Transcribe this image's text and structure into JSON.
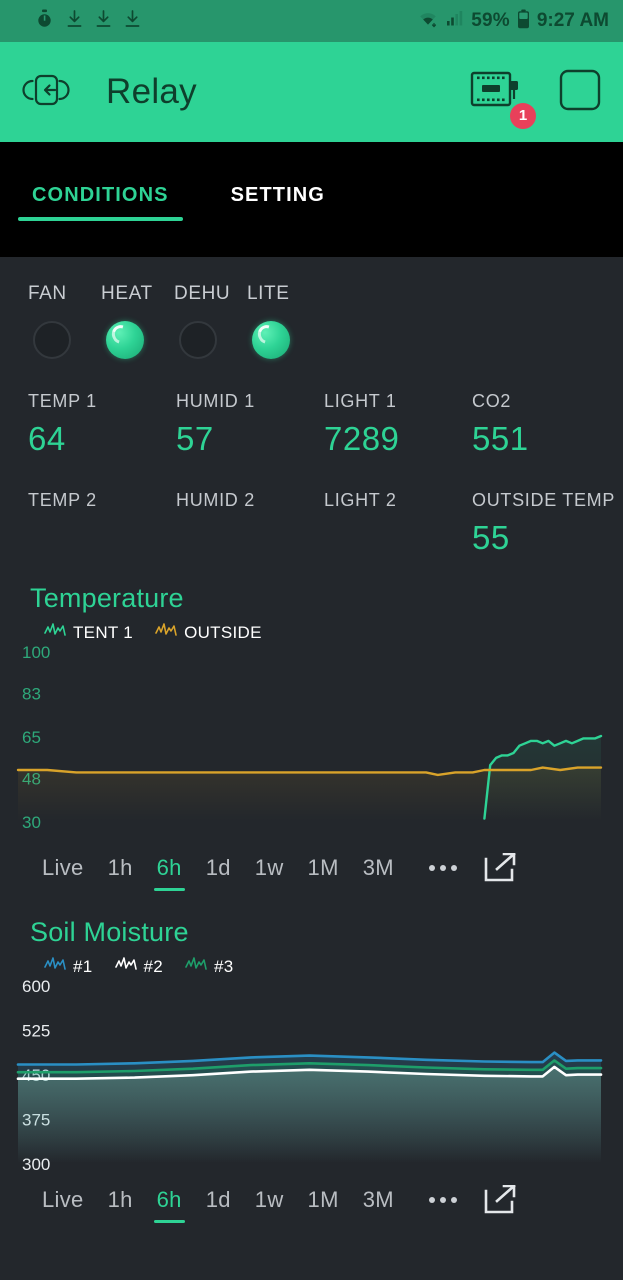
{
  "statusbar": {
    "icons": [
      "stopwatch-icon",
      "download-icon",
      "download-icon",
      "download-icon",
      "wifi-icon",
      "cell-signal-icon",
      "battery-icon"
    ],
    "battery_percent": "59%",
    "clock": "9:27 AM"
  },
  "appbar": {
    "back_icon": "exit-to-app-icon",
    "title": "Relay",
    "device_icon": "microchip-icon",
    "device_badge": "1",
    "square_icon": "square-outline-icon"
  },
  "tabs": [
    {
      "label": "CONDITIONS",
      "active": true
    },
    {
      "label": "SETTING",
      "active": false
    }
  ],
  "relays": [
    {
      "label": "FAN",
      "state": "off"
    },
    {
      "label": "HEAT",
      "state": "on"
    },
    {
      "label": "DEHU",
      "state": "off"
    },
    {
      "label": "LITE",
      "state": "on"
    }
  ],
  "sensors": {
    "row1": [
      {
        "name": "TEMP 1",
        "value": "64"
      },
      {
        "name": "HUMID 1",
        "value": "57"
      },
      {
        "name": "LIGHT 1",
        "value": "7289"
      },
      {
        "name": "CO2",
        "value": "551"
      }
    ],
    "row2": [
      {
        "name": "TEMP 2",
        "value": ""
      },
      {
        "name": "HUMID 2",
        "value": ""
      },
      {
        "name": "LIGHT 2",
        "value": ""
      },
      {
        "name": "OUTSIDE TEMP",
        "value": "55"
      }
    ]
  },
  "ranges": [
    "Live",
    "1h",
    "6h",
    "1d",
    "1w",
    "1M",
    "3M"
  ],
  "range_active": "6h",
  "more_icon": "ellipsis-icon",
  "share_icon": "open-in-new-icon",
  "colors": {
    "accent": "#2ed395",
    "app_bar": "#2ed395",
    "status_bar": "#27966c",
    "background": "#23272c",
    "tabbar": "#000000",
    "badge": "#e8405a",
    "series_tent1": "#2ed395",
    "series_outside": "#d9a32a",
    "series_soil1": "#2a8fc4",
    "series_soil2": "#ffffff",
    "series_soil3": "#1e9e6a"
  },
  "chart_data": [
    {
      "type": "line",
      "title": "Temperature",
      "xlabel": "",
      "ylabel": "",
      "ylim": [
        30,
        100
      ],
      "yticks": [
        100,
        83,
        65,
        48,
        30
      ],
      "grid": false,
      "legend_position": "top-left",
      "x_range_label": "6h",
      "series": [
        {
          "name": "TENT 1",
          "color": "#2ed395",
          "x": [
            0,
            79,
            80,
            81,
            82,
            83,
            84,
            85,
            86,
            87,
            88,
            89,
            90,
            91,
            92,
            93,
            94,
            95,
            96,
            97,
            98,
            99,
            100
          ],
          "y": [
            null,
            null,
            31,
            53,
            56,
            57,
            57,
            58,
            61,
            62,
            63,
            63,
            62,
            63,
            61,
            62,
            63,
            62,
            63,
            64,
            64,
            64,
            65
          ]
        },
        {
          "name": "OUTSIDE",
          "color": "#d9a32a",
          "x": [
            0,
            5,
            10,
            15,
            20,
            25,
            30,
            35,
            40,
            45,
            50,
            55,
            60,
            65,
            70,
            72,
            75,
            78,
            80,
            82,
            85,
            88,
            90,
            93,
            96,
            100
          ],
          "y": [
            51,
            51,
            50,
            50,
            50,
            50,
            50,
            50,
            50,
            50,
            50,
            50,
            50,
            50,
            50,
            49,
            50,
            50,
            51,
            51,
            51,
            51,
            52,
            51,
            52,
            52
          ]
        }
      ]
    },
    {
      "type": "line",
      "title": "Soil Moisture",
      "xlabel": "",
      "ylabel": "",
      "ylim": [
        300,
        600
      ],
      "yticks": [
        600,
        525,
        450,
        375,
        300
      ],
      "grid": false,
      "legend_position": "top-left",
      "x_range_label": "6h",
      "series": [
        {
          "name": "#1",
          "color": "#2a8fc4",
          "x": [
            0,
            10,
            20,
            30,
            40,
            50,
            60,
            70,
            80,
            88,
            90,
            92,
            94,
            96,
            100
          ],
          "y": [
            466,
            466,
            468,
            472,
            478,
            481,
            478,
            474,
            471,
            470,
            470,
            486,
            472,
            473,
            473
          ]
        },
        {
          "name": "#2",
          "color": "#ffffff",
          "x": [
            0,
            10,
            20,
            30,
            40,
            50,
            60,
            70,
            80,
            88,
            90,
            92,
            94,
            96,
            100
          ],
          "y": [
            442,
            442,
            444,
            448,
            454,
            457,
            454,
            450,
            447,
            446,
            446,
            462,
            448,
            449,
            449
          ]
        },
        {
          "name": "#3",
          "color": "#1e9e6a",
          "x": [
            0,
            10,
            20,
            30,
            40,
            50,
            60,
            70,
            80,
            88,
            90,
            92,
            94,
            96,
            100
          ],
          "y": [
            453,
            453,
            455,
            459,
            465,
            468,
            465,
            461,
            458,
            457,
            457,
            473,
            459,
            460,
            460
          ]
        }
      ]
    }
  ]
}
